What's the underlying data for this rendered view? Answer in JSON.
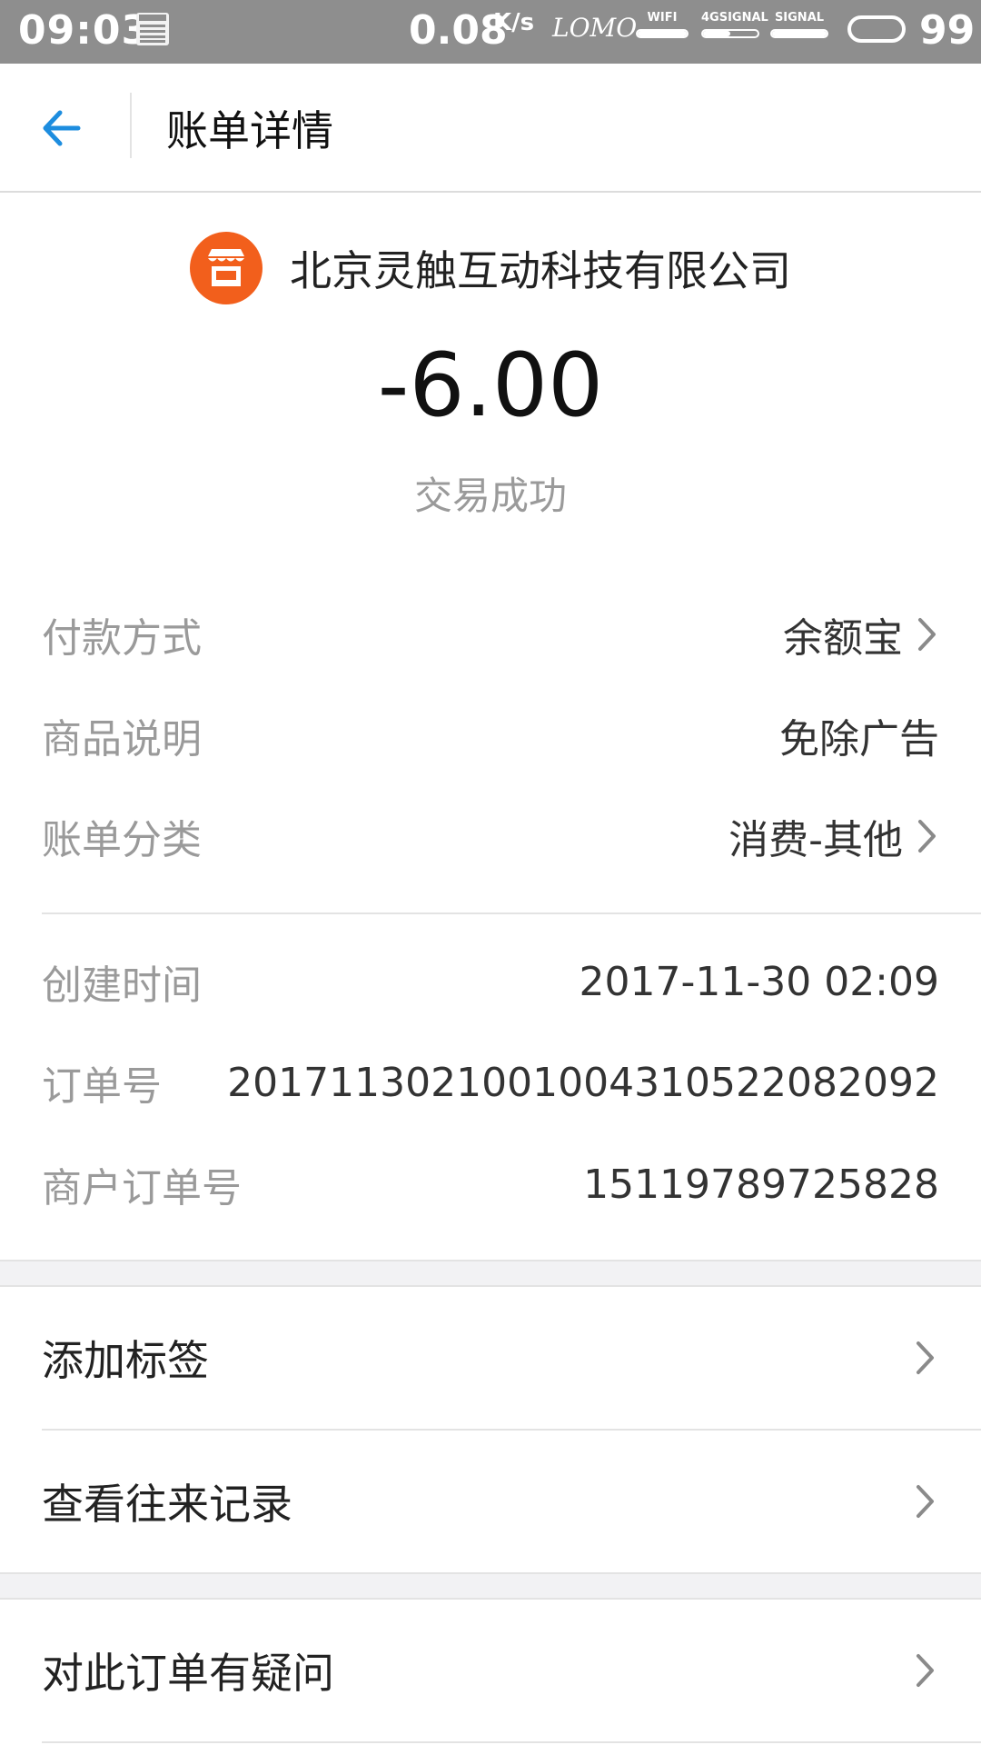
{
  "status_bar": {
    "time": "09:03",
    "speed": "0.08",
    "speed_unit": "K/s",
    "carrier": "LOMO",
    "wifi_label": "WIFI",
    "signal_4g_label": "4GSIGNAL",
    "signal_label": "SIGNAL",
    "battery": "99"
  },
  "header": {
    "title": "账单详情"
  },
  "summary": {
    "merchant": "北京灵触互动科技有限公司",
    "amount": "-6.00",
    "status": "交易成功"
  },
  "details_a": [
    {
      "label": "付款方式",
      "value": "余额宝",
      "chevron": true
    },
    {
      "label": "商品说明",
      "value": "免除广告",
      "chevron": false
    },
    {
      "label": "账单分类",
      "value": "消费-其他",
      "chevron": true
    }
  ],
  "details_b": [
    {
      "label": "创建时间",
      "value": "2017-11-30 02:09"
    },
    {
      "label": "订单号",
      "value": "2017113021001004310522082092"
    },
    {
      "label": "商户订单号",
      "value": "15119789725828"
    }
  ],
  "actions": {
    "add_tag": "添加标签",
    "view_history": "查看往来记录",
    "question": "对此订单有疑问"
  },
  "colors": {
    "accent": "#1d8ddf",
    "merchant_logo": "#f25f1c",
    "status_bar": "#8e8e8e",
    "band": "#f2f2f4"
  },
  "icons": {
    "back": "arrow-left-icon",
    "merchant": "shop-icon",
    "chevron": "chevron-right-icon"
  }
}
